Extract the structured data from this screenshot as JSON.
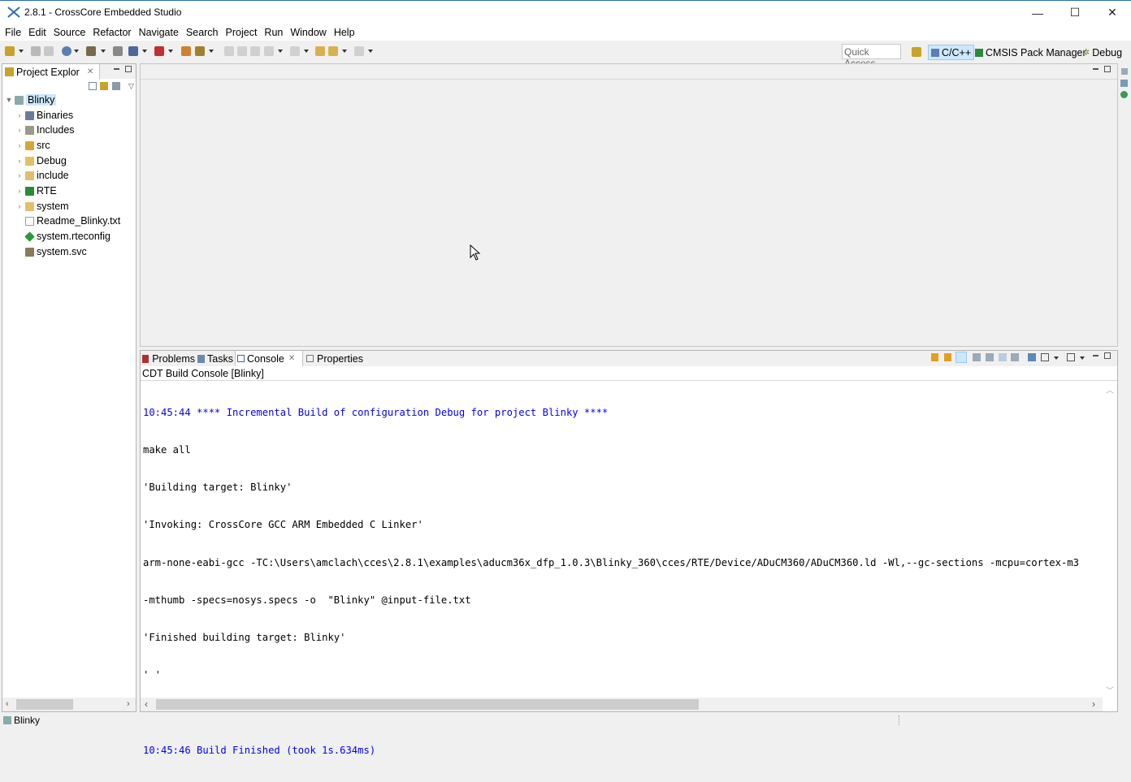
{
  "window": {
    "title": "2.8.1 - CrossCore Embedded Studio",
    "controls": {
      "minimize": "—",
      "maximize": "☐",
      "close": "✕"
    }
  },
  "menu": [
    "File",
    "Edit",
    "Source",
    "Refactor",
    "Navigate",
    "Search",
    "Project",
    "Run",
    "Window",
    "Help"
  ],
  "toolbar": {
    "quick_access_placeholder": "Quick Access",
    "perspectives": [
      "C/C++",
      "CMSIS Pack Manager",
      "Debug"
    ]
  },
  "project_explorer": {
    "tab_label": "Project Explor",
    "root": "Blinky",
    "items": [
      {
        "label": "Binaries",
        "icon": "binaries-icon",
        "expandable": true
      },
      {
        "label": "Includes",
        "icon": "includes-icon",
        "expandable": true
      },
      {
        "label": "src",
        "icon": "source-folder-icon",
        "expandable": true
      },
      {
        "label": "Debug",
        "icon": "folder-icon",
        "expandable": true
      },
      {
        "label": "include",
        "icon": "folder-icon",
        "expandable": true
      },
      {
        "label": "RTE",
        "icon": "rte-icon",
        "expandable": true
      },
      {
        "label": "system",
        "icon": "folder-icon",
        "expandable": true
      },
      {
        "label": "Readme_Blinky.txt",
        "icon": "text-file-icon",
        "expandable": false
      },
      {
        "label": "system.rteconfig",
        "icon": "rteconfig-icon",
        "expandable": false
      },
      {
        "label": "system.svc",
        "icon": "svc-file-icon",
        "expandable": false
      }
    ]
  },
  "console_panel": {
    "tabs": [
      "Problems",
      "Tasks",
      "Console",
      "Properties"
    ],
    "active_tab": "Console",
    "console_name": "CDT Build Console [Blinky]",
    "lines": [
      {
        "text": "10:45:44 **** Incremental Build of configuration Debug for project Blinky ****",
        "style": "info"
      },
      {
        "text": "make all",
        "style": "normal"
      },
      {
        "text": "'Building target: Blinky'",
        "style": "normal"
      },
      {
        "text": "'Invoking: CrossCore GCC ARM Embedded C Linker'",
        "style": "normal"
      },
      {
        "text": "arm-none-eabi-gcc -TC:\\Users\\amclach\\cces\\2.8.1\\examples\\aducm36x_dfp_1.0.3\\Blinky_360\\cces/RTE/Device/ADuCM360/ADuCM360.ld -Wl,--gc-sections -mcpu=cortex-m3",
        "style": "normal"
      },
      {
        "text": "-mthumb -specs=nosys.specs -o  \"Blinky\" @input-file.txt",
        "style": "normal"
      },
      {
        "text": "'Finished building target: Blinky'",
        "style": "normal"
      },
      {
        "text": "' '",
        "style": "normal"
      },
      {
        "text": "",
        "style": "normal"
      },
      {
        "text": "10:45:46 Build Finished (took 1s.634ms)",
        "style": "info"
      }
    ]
  },
  "status_bar": {
    "selection": "Blinky"
  },
  "colors": {
    "info_text": "#0000ff",
    "selection_bg": "#cce8ff",
    "accent": "#2b6cb0"
  }
}
